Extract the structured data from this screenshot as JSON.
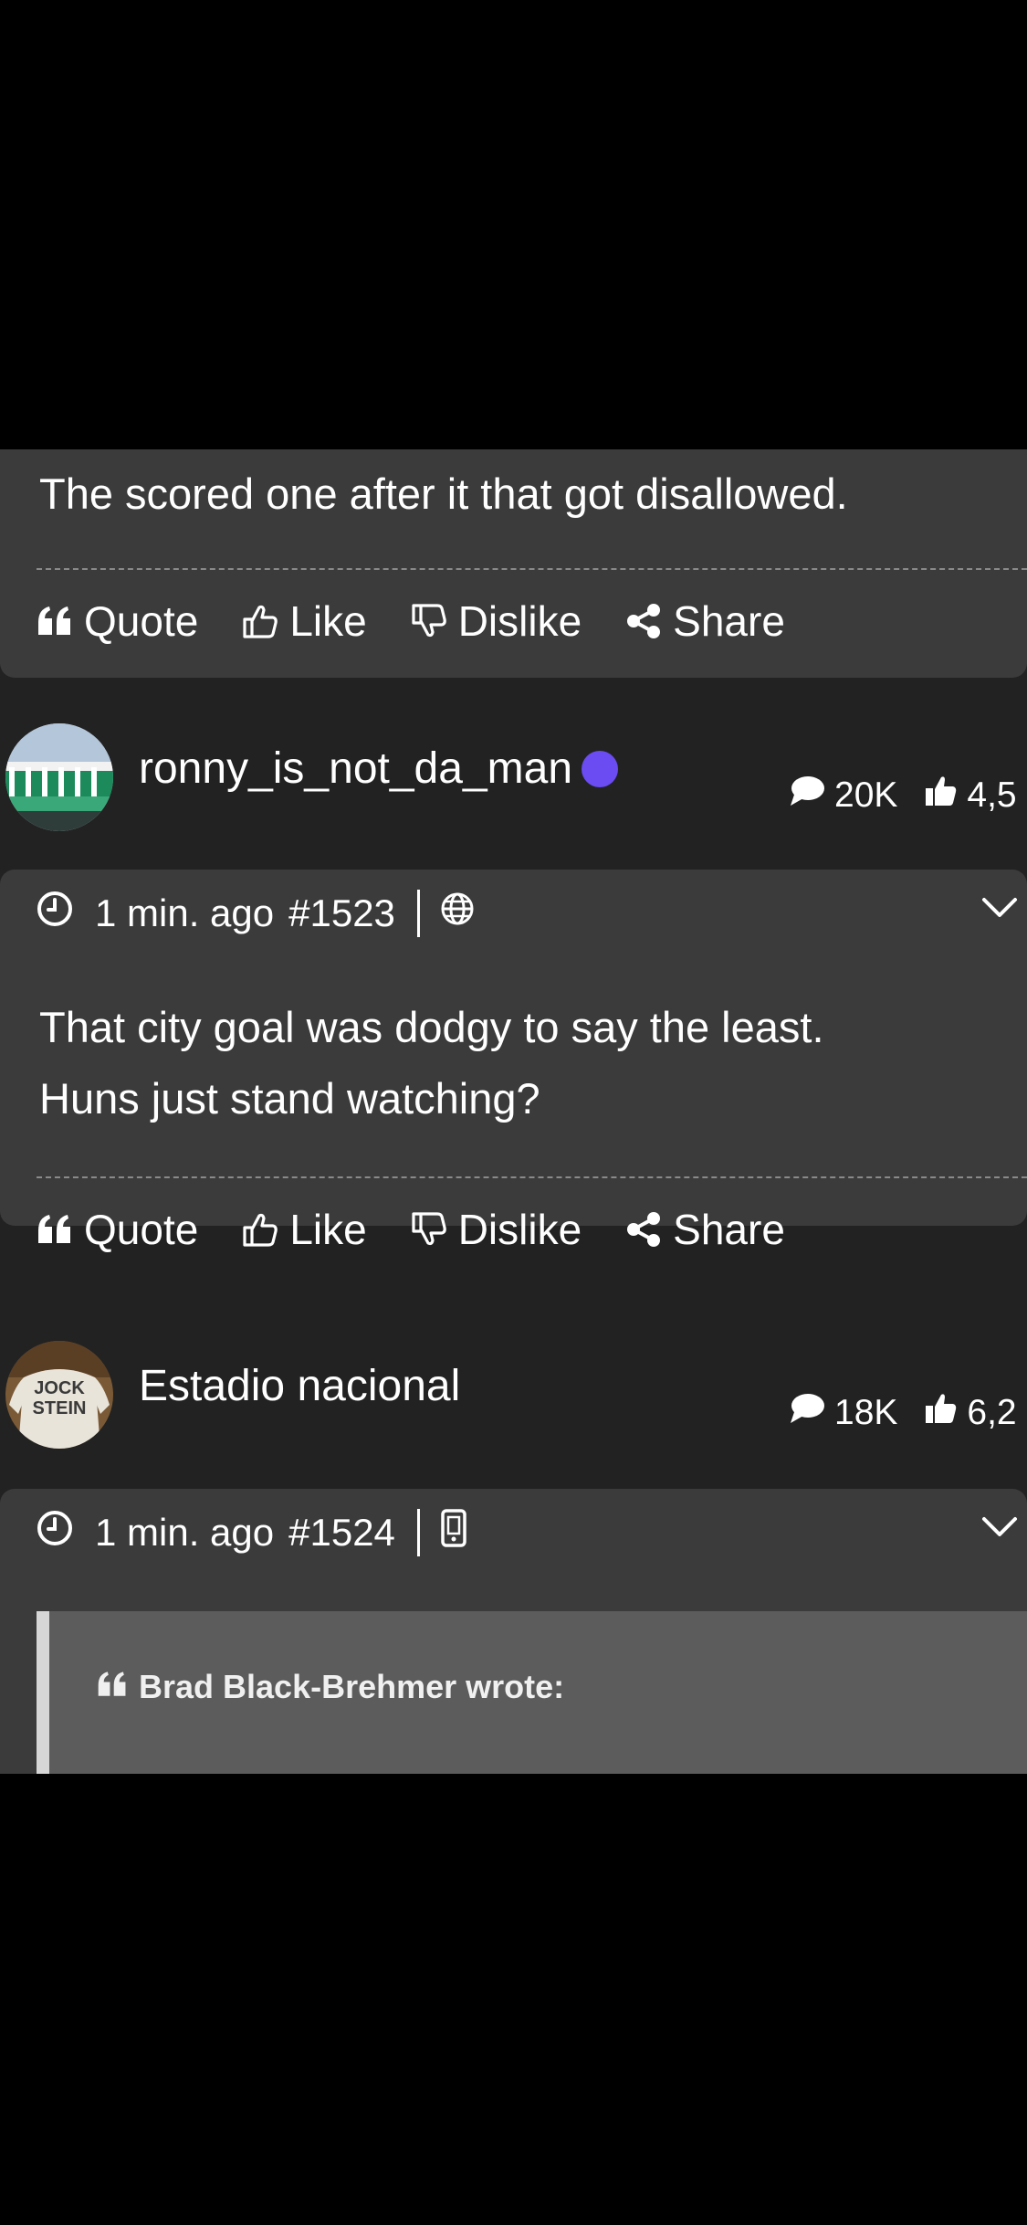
{
  "colors": {
    "page_background": "#000000",
    "feed_background": "#222222",
    "card_background": "#3b3b3b",
    "quote_background": "#5c5c5c",
    "online_dot": "#6b4bf2"
  },
  "post_actions": {
    "quote": "Quote",
    "like": "Like",
    "dislike": "Dislike",
    "share": "Share"
  },
  "previous_post": {
    "text": "The scored one after it that got disallowed."
  },
  "posts": [
    {
      "author": {
        "name": "ronny_is_not_da_man",
        "online": true,
        "message_count": "20K",
        "like_count": "4,5"
      },
      "time": "1 min. ago",
      "number": "#1523",
      "platform_icon": "globe-icon",
      "text_lines": [
        "That city goal was dodgy to say the least.",
        "Huns just stand watching?"
      ]
    },
    {
      "author": {
        "name": "Estadio nacional",
        "online": false,
        "message_count": "18K",
        "like_count": "6,2"
      },
      "time": "1 min. ago",
      "number": "#1524",
      "platform_icon": "mobile-phone-icon",
      "quote": {
        "author_line": "Brad Black-Brehmer wrote:"
      }
    }
  ]
}
